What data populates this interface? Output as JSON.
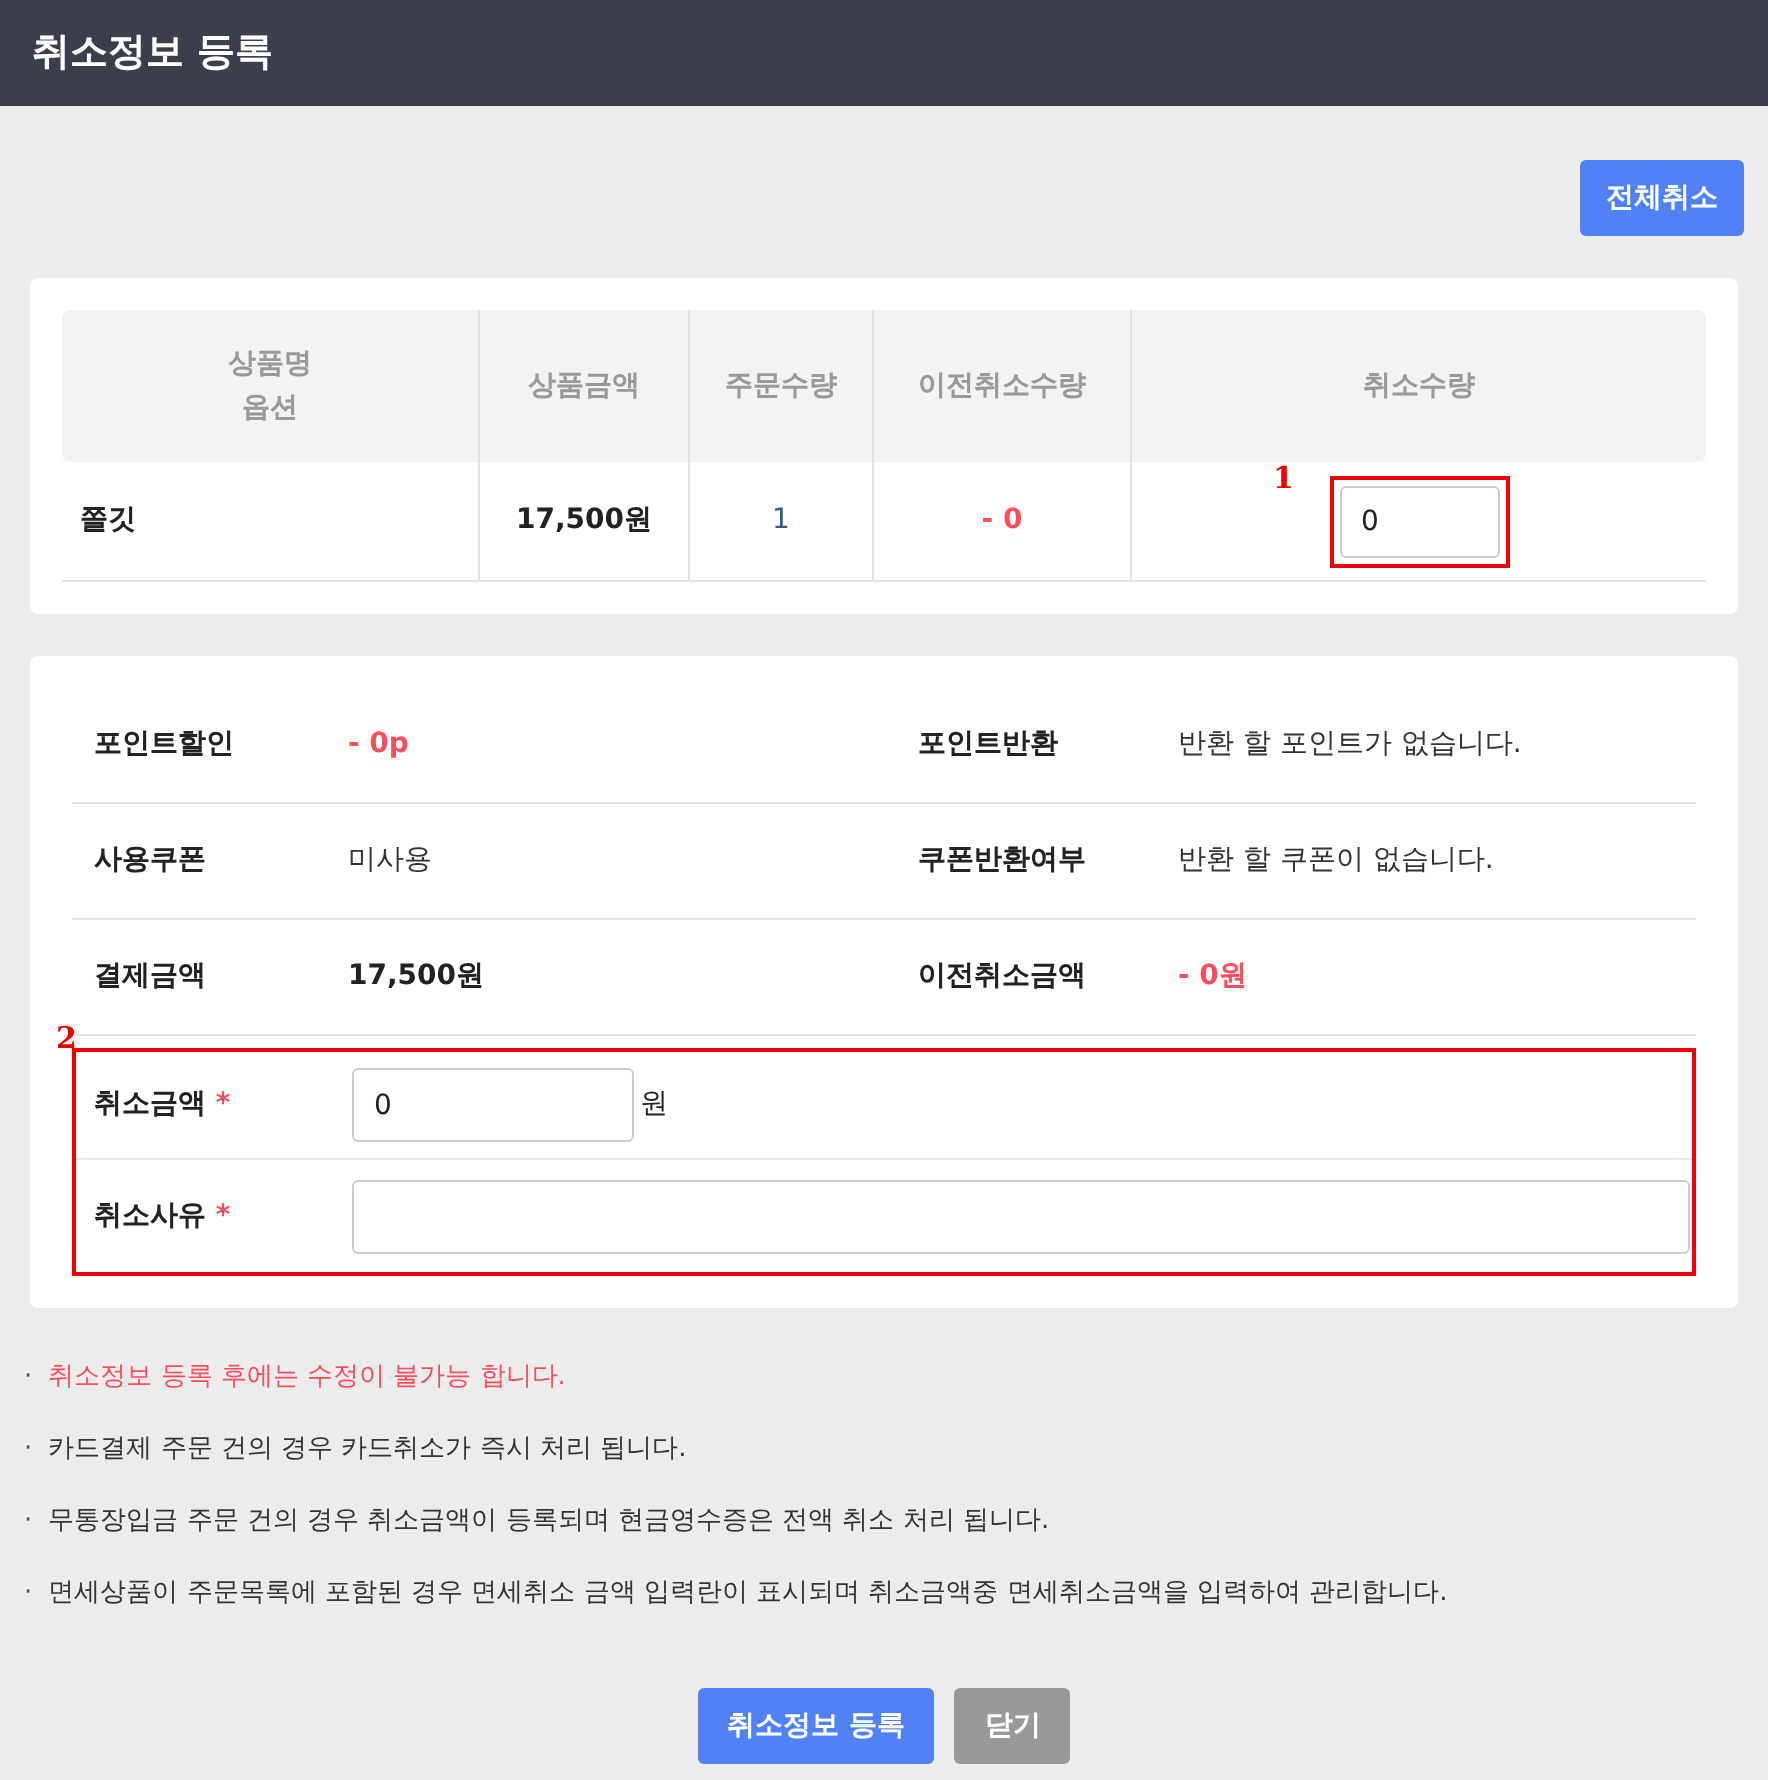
{
  "header": {
    "title": "취소정보 등록"
  },
  "cancel_all_button": "전체취소",
  "product_table": {
    "columns": [
      [
        "상품명",
        "옵션"
      ],
      [
        "상품금액"
      ],
      [
        "주문수량"
      ],
      [
        "이전취소수량"
      ],
      [
        "취소수량"
      ]
    ],
    "rows": [
      {
        "name": "쫄깃",
        "price": "17,500원",
        "quantity": "1",
        "previous_cancel": "- 0",
        "cancel_quantity": "0",
        "annotation": "1"
      }
    ]
  },
  "summary": [
    {
      "cells": [
        {
          "label": "포인트할인",
          "value": "- 0p",
          "kind": "negative"
        },
        {
          "label": "포인트반환",
          "value": "반환 할 포인트가 없습니다.",
          "kind": "plain"
        }
      ]
    },
    {
      "cells": [
        {
          "label": "사용쿠폰",
          "value": "미사용",
          "kind": "plain"
        },
        {
          "label": "쿠폰반환여부",
          "value": "반환 할 쿠폰이 없습니다.",
          "kind": "plain"
        }
      ]
    },
    {
      "cells": [
        {
          "label": "결제금액",
          "value": "17,500원",
          "kind": "bold"
        },
        {
          "label": "이전취소금액",
          "value": "- 0원",
          "kind": "negative"
        }
      ]
    }
  ],
  "cancel_form": {
    "annotation": "2",
    "amount": {
      "label": "취소금액",
      "required_mark": "*",
      "value": "0",
      "unit": "원"
    },
    "reason": {
      "label": "취소사유",
      "required_mark": "*"
    }
  },
  "notes": [
    {
      "bullet": "·",
      "text": "취소정보 등록 후에는 수정이 불가능 합니다.",
      "kind": "warning"
    },
    {
      "bullet": "·",
      "text": "카드결제 주문 건의 경우 카드취소가 즉시 처리 됩니다.",
      "kind": "normal"
    },
    {
      "bullet": "·",
      "text": "무통장입금 주문 건의 경우 취소금액이 등록되며 현금영수증은 전액 취소 처리 됩니다.",
      "kind": "normal"
    },
    {
      "bullet": "·",
      "text": "면세상품이 주문목록에 포함된 경우 면세취소 금액 입력란이 표시되며 취소금액중 면세취소금액을 입력하여 관리합니다.",
      "kind": "normal"
    }
  ],
  "buttons": [
    {
      "label": "취소정보 등록",
      "kind": "primary"
    },
    {
      "label": "닫기",
      "kind": "secondary"
    }
  ]
}
